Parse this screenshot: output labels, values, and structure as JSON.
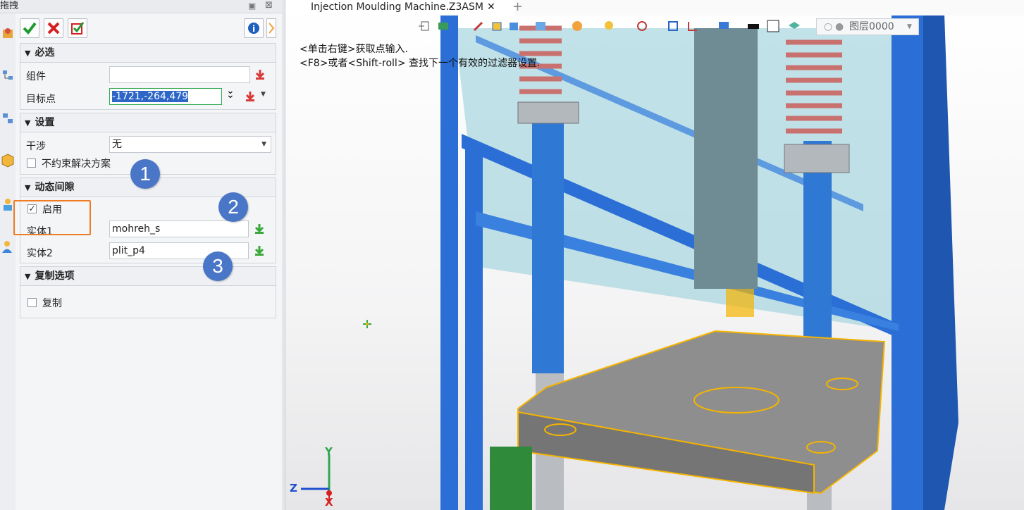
{
  "panel": {
    "title": "拖拽",
    "pin_glyph": "▣",
    "close_glyph": "⊠",
    "ok_icon": "check-icon",
    "cancel_icon": "cross-icon",
    "apply_icon": "apply-icon",
    "info_icon": "info-icon"
  },
  "sections": {
    "required": {
      "title": "必选"
    },
    "settings": {
      "title": "设置"
    },
    "dynamic": {
      "title": "动态间隙"
    },
    "copy": {
      "title": "复制选项"
    }
  },
  "fields": {
    "component_label": "组件",
    "component_value": "",
    "target_label": "目标点",
    "target_value": "-1721,-264,479",
    "interference_label": "干涉",
    "interference_value": "无",
    "no_constraint_label": "不约束解决方案",
    "enable_label": "启用",
    "entity1_label": "实体1",
    "entity1_value": "mohreh_s",
    "entity2_label": "实体2",
    "entity2_value": "plit_p4",
    "copy_label": "复制"
  },
  "badges": [
    "1",
    "2",
    "3"
  ],
  "viewport": {
    "tab_title": "Injection Moulding  Machine.Z3ASM",
    "tab_close": "✕",
    "tab_add": "+",
    "hint_line1": "<单击右键>获取点输入.",
    "hint_line2": "<F8>或者<Shift-roll> 查找下一个有效的过滤器设置.",
    "layer_label": "图层0000",
    "axis_y": "Y",
    "axis_z": "Z",
    "axis_x": "X"
  },
  "colors": {
    "accent_blue": "#4a76c7",
    "highlight_orange": "#f07b22",
    "selection_yellow": "#f5b400",
    "frame_blue": "#2b6fd6",
    "glass_cyan": "#9fd3dc"
  }
}
